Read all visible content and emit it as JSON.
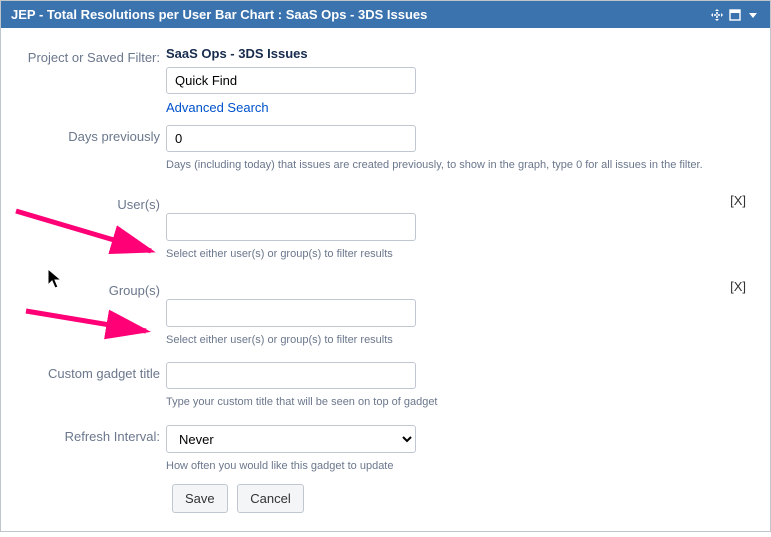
{
  "header": {
    "title": "JEP - Total Resolutions per User Bar Chart : SaaS Ops - 3DS Issues"
  },
  "filter": {
    "label": "Project or Saved Filter:",
    "value_display": "SaaS Ops - 3DS Issues",
    "quickfind_value": "Quick Find",
    "advanced_search": "Advanced Search"
  },
  "days": {
    "label": "Days previously",
    "value": "0",
    "help": "Days (including today) that issues are created previously, to show in the graph, type 0 for all issues in the filter."
  },
  "users": {
    "label": "User(s)",
    "value": "",
    "help": "Select either user(s) or group(s) to filter results",
    "clear": "[X]"
  },
  "groups": {
    "label": "Group(s)",
    "value": "",
    "help": "Select either user(s) or group(s) to filter results",
    "clear": "[X]"
  },
  "custom_title": {
    "label": "Custom gadget title",
    "value": "",
    "help": "Type your custom title that will be seen on top of gadget"
  },
  "refresh": {
    "label": "Refresh Interval:",
    "selected": "Never",
    "help": "How often you would like this gadget to update"
  },
  "buttons": {
    "save": "Save",
    "cancel": "Cancel"
  }
}
